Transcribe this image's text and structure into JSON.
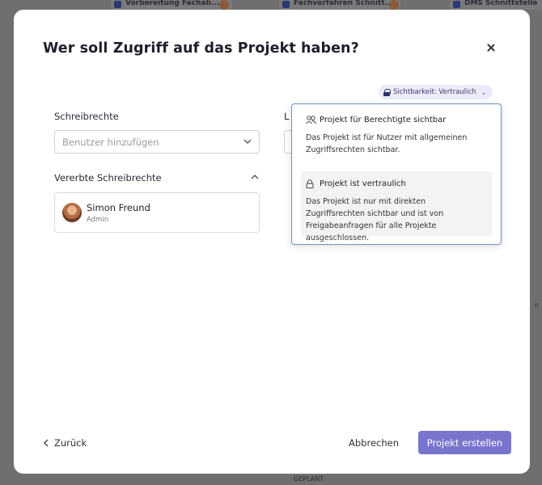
{
  "background": {
    "cards": [
      "Vorbereitung Fachab...",
      "Fachverfahren Schnitt...",
      "DMS Schnittstelle"
    ],
    "right_fragment": "n",
    "bottom_status": "GEPLANT"
  },
  "modal": {
    "title": "Wer soll Zugriff auf das Projekt haben?",
    "visibility_badge": "Sichtbarkeit: Vertraulich",
    "write_rights_label": "Schreibrechte",
    "read_rights_label_partial": "L",
    "add_user_placeholder": "Benutzer hinzufügen",
    "inherited_label": "Vererbte Schreibrechte",
    "inherited_users": [
      {
        "name": "Simon Freund",
        "role": "Admin"
      }
    ],
    "visibility_options": [
      {
        "title": "Projekt für Berechtigte sichtbar",
        "description": "Das Projekt ist für Nutzer mit allgemeinen Zugriffsrechten sichtbar.",
        "icon": "people-icon",
        "selected": false
      },
      {
        "title": "Projekt ist vertraulich",
        "description": "Das Projekt ist nur mit direkten Zugriffsrechten sichtbar und ist von Freigabeanfragen für alle Projekte ausgeschlossen.",
        "icon": "lock-outline-icon",
        "selected": true
      }
    ],
    "footer": {
      "back": "Zurück",
      "cancel": "Abbrechen",
      "primary": "Projekt erstellen"
    }
  },
  "colors": {
    "primary": "#7a75cc",
    "badge_bg": "#ecebfb",
    "overlay": "#6f6f70"
  }
}
